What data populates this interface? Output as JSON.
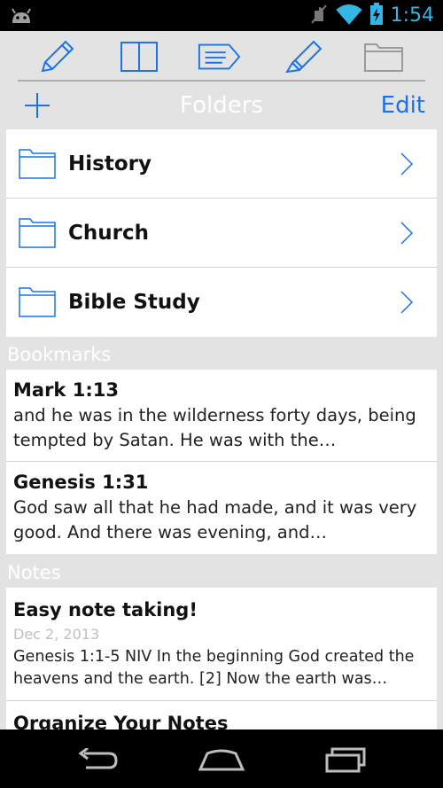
{
  "status": {
    "time": "1:54",
    "icons": [
      "android-icon",
      "mute-icon",
      "wifi-icon",
      "battery-charging-icon"
    ]
  },
  "toolbar": {
    "icons": [
      "pencil-icon",
      "book-icon",
      "tag-icon",
      "highlighter-icon",
      "folder-icon"
    ]
  },
  "nav": {
    "title": "Folders",
    "edit_label": "Edit",
    "add_icon": "plus-icon"
  },
  "folders": [
    {
      "label": "History"
    },
    {
      "label": "Church"
    },
    {
      "label": "Bible Study"
    }
  ],
  "bookmarks": {
    "header": "Bookmarks",
    "items": [
      {
        "ref": "Mark 1:13",
        "text": "and he was in the wilderness forty days, being tempted by Satan. He was with the…"
      },
      {
        "ref": "Genesis 1:31",
        "text": "God saw all that he had made, and it was very good. And there was evening, and…"
      }
    ]
  },
  "notes": {
    "header": "Notes",
    "items": [
      {
        "title": "Easy note taking!",
        "date": "Dec 2, 2013",
        "text": "Genesis 1:1-5 NIV In the beginning God created the heavens and the earth. [2] Now the earth was…"
      },
      {
        "title": "Organize Your Notes",
        "date": "",
        "text": ""
      }
    ]
  },
  "colors": {
    "accent": "#1a73e8",
    "background": "#e3e3e3",
    "status_accent": "#33b5e5"
  }
}
